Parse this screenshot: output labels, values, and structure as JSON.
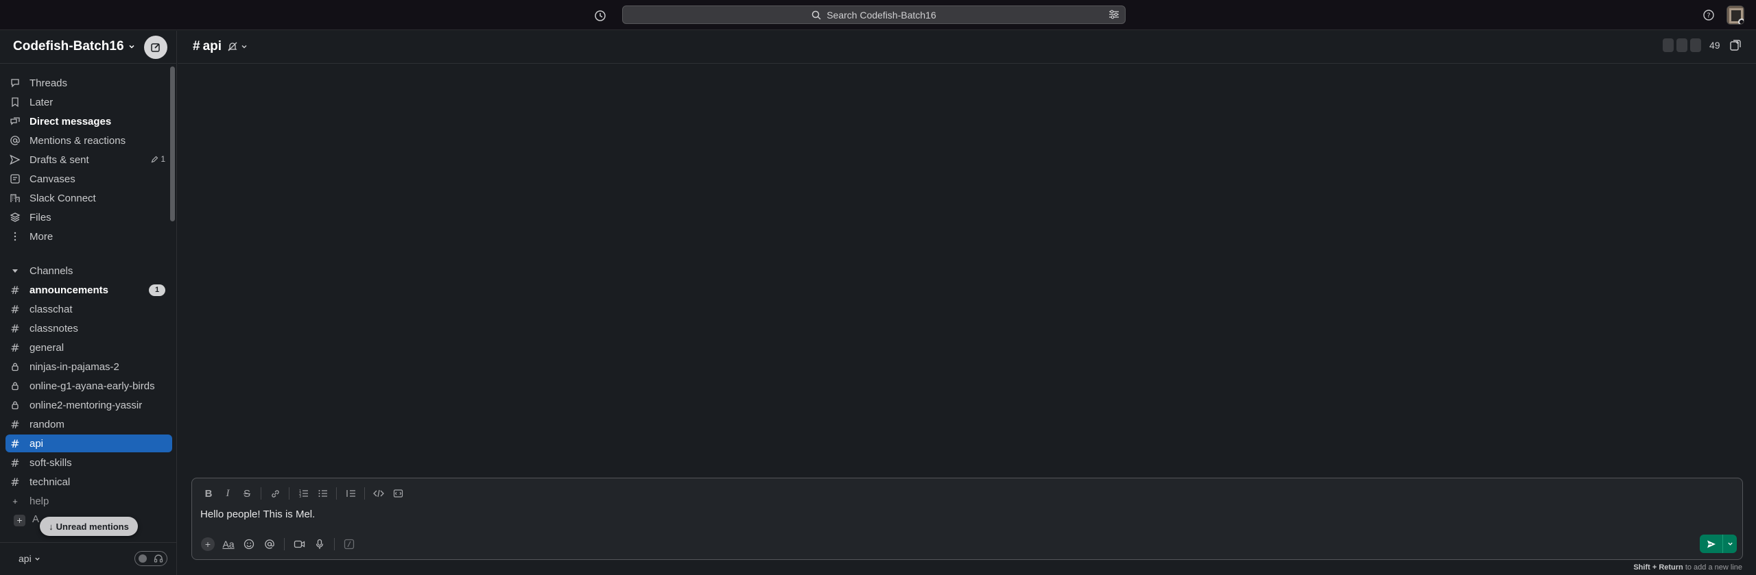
{
  "search": {
    "placeholder": "Search Codefish-Batch16"
  },
  "workspace": {
    "name": "Codefish-Batch16"
  },
  "nav": [
    {
      "label": "Threads",
      "icon": "threads-icon"
    },
    {
      "label": "Later",
      "icon": "bookmark-icon"
    },
    {
      "label": "Direct messages",
      "icon": "direct-messages-icon"
    },
    {
      "label": "Mentions & reactions",
      "icon": "at-icon"
    },
    {
      "label": "Drafts & sent",
      "icon": "send-icon",
      "count": "1"
    },
    {
      "label": "Canvases",
      "icon": "canvas-icon"
    },
    {
      "label": "Slack Connect",
      "icon": "building-icon"
    },
    {
      "label": "Files",
      "icon": "files-icon"
    },
    {
      "label": "More",
      "icon": "more-vertical-icon"
    }
  ],
  "channels_section": {
    "label": "Channels"
  },
  "channels": [
    {
      "name": "announcements",
      "type": "public",
      "unread": true,
      "badge": "1"
    },
    {
      "name": "classchat",
      "type": "public"
    },
    {
      "name": "classnotes",
      "type": "public"
    },
    {
      "name": "general",
      "type": "public"
    },
    {
      "name": "ninjas-in-pajamas-2",
      "type": "private"
    },
    {
      "name": "online-g1-ayana-early-birds",
      "type": "private"
    },
    {
      "name": "online2-mentoring-yassir",
      "type": "private"
    },
    {
      "name": "random",
      "type": "public"
    },
    {
      "name": "api",
      "type": "public",
      "active": true
    },
    {
      "name": "soft-skills",
      "type": "public"
    },
    {
      "name": "technical",
      "type": "public"
    },
    {
      "name": "help",
      "type": "plus"
    }
  ],
  "add_partial": "A",
  "unread_mentions": {
    "label": "Unread mentions"
  },
  "footer": {
    "workspace_short": "api"
  },
  "channel_header": {
    "name": "api",
    "member_count": "49"
  },
  "composer": {
    "text": "Hello people! This is Mel.",
    "hint_keys": "Shift + Return",
    "hint_text": " to add a new line"
  },
  "colors": {
    "active": "#1d64b8",
    "send": "#007a5a",
    "background": "#1a1d21",
    "topbar": "#121016"
  }
}
